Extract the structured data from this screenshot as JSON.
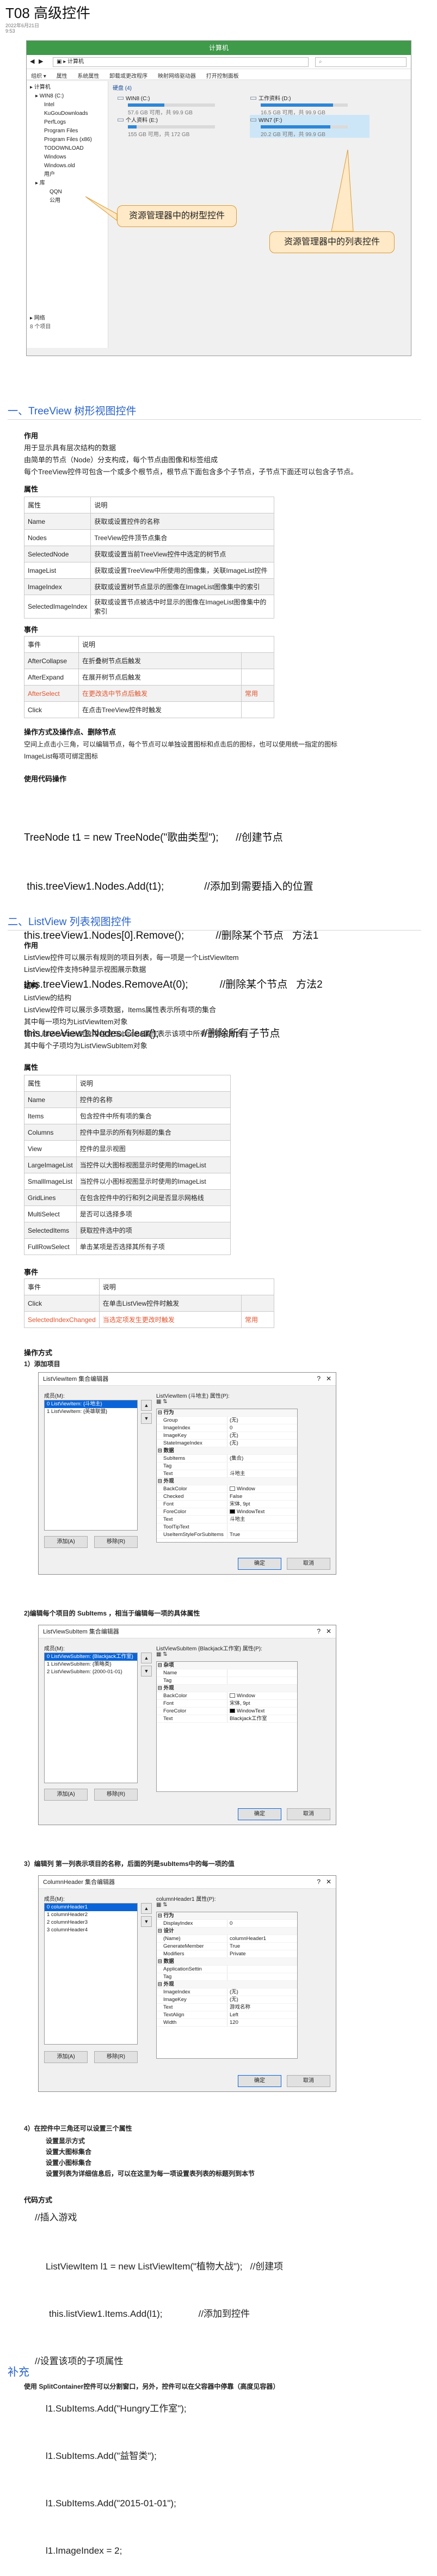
{
  "page": {
    "title": "T08 高级控件",
    "date": "2022年6月21日",
    "time": "9:53"
  },
  "explorer": {
    "window_title": "计算机",
    "path": "计算机",
    "menu": [
      "组织 ▾",
      "属性",
      "系统属性",
      "卸载或更改程序",
      "映射网络驱动器",
      "打开控制面板"
    ],
    "tree": [
      "▸ 计算机",
      "▸ WIN8 (C:)",
      "Intel",
      "KuGouDownloads",
      "PerfLogs",
      "Program Files",
      "Program Files (x86)",
      "TODOWNLOAD",
      "Windows",
      "Windows.old",
      "用户",
      "▸ 库",
      "QQN",
      "公用",
      "▸ 网络"
    ],
    "tree_footer": "8 个项目",
    "group": "硬盘 (4)",
    "drives": [
      {
        "name": "WIN8 (C:)",
        "free": "57.6 GB 可用，共 99.9 GB",
        "used": 0.42
      },
      {
        "name": "工作资料 (D:)",
        "free": "16.5 GB 可用，共 99.9 GB",
        "used": 0.83
      },
      {
        "name": "个人资料 (E:)",
        "free": "155 GB 可用，共 172 GB",
        "used": 0.1
      },
      {
        "name": "WIN7 (F:)",
        "free": "20.2 GB 可用，共 99.9 GB",
        "used": 0.8
      }
    ],
    "callout_tree": "资源管理器中的树型控件",
    "callout_list": "资源管理器中的列表控件"
  },
  "treeview": {
    "heading": "一、TreeView 树形视图控件",
    "purpose_label": "作用",
    "purpose_lines": [
      "用于显示具有层次结构的数据",
      "由简单的节点（Node）分支构成，每个节点由图像和标签组成",
      "每个TreeView控件可包含一个或多个根节点，根节点下面包含多个子节点，子节点下面还可以包含子节点。"
    ],
    "props_label": "属性",
    "props_header": [
      "属性",
      "说明"
    ],
    "props": [
      [
        "Name",
        "获取或设置控件的名称"
      ],
      [
        "Nodes",
        "TreeView控件顶节点集合"
      ],
      [
        "SelectedNode",
        "获取或设置当前TreeView控件中选定的树节点"
      ],
      [
        "ImageList",
        "获取或设置TreeView中所使用的图像集，关联ImageList控件"
      ],
      [
        "ImageIndex",
        "获取或设置树节点显示的图像在ImageList图像集中的索引"
      ],
      [
        "SelectedImageIndex",
        "获取或设置节点被选中时显示的图像在ImageList图像集中的索引"
      ]
    ],
    "events_label": "事件",
    "events_header": [
      "事件",
      "说明"
    ],
    "events": [
      [
        "AfterCollapse",
        "在折叠树节点后触发",
        ""
      ],
      [
        "AfterExpand",
        "在展开树节点后触发",
        ""
      ],
      [
        "AfterSelect",
        "在更改选中节点后触发",
        "常用"
      ],
      [
        "Click",
        "在点击TreeView控件时触发",
        ""
      ]
    ],
    "ops_label": "操作方式及操作点、删除节点",
    "ops_lines": [
      "空间上点击小三角，可以编辑节点，每个节点可以单独设置图标和点击后的图标，也可以使用统一指定的图标",
      "ImageList每项可绑定图标"
    ],
    "code_label": "使用代码操作",
    "code": [
      "TreeNode t1 = new TreeNode(\"歌曲类型\");      //创建节点",
      " this.treeView1.Nodes.Add(t1);              //添加到需要插入的位置",
      "this.treeView1.Nodes[0].Remove();           //删除某个节点   方法1",
      "this.treeView1.Nodes.RemoveAt(0);           //删除某个节点   方法2",
      "this.treeView1.Nodes.Clear();               //删除所有子节点"
    ]
  },
  "listview": {
    "heading": "二、ListView 列表视图控件",
    "purpose_label": "作用",
    "purpose_lines": [
      "ListView控件可以展示有规则的项目列表，每一项是一个ListViewItem",
      "ListView控件支持5种显示视图展示数据"
    ],
    "struct_label": "结构",
    "struct_lines": [
      "ListView的结构",
      "ListView控件可以展示多项数据，Items属性表示所有项的集合",
      "其中每一项均为ListViewItem对象",
      "每个ListViewItem对象中包含SubItems属性表示该项中所有子项的集合",
      "其中每个子项均为ListViewSubItem对象"
    ],
    "props_label": "属性",
    "props_header": [
      "属性",
      "说明"
    ],
    "props": [
      [
        "Name",
        "控件的名称"
      ],
      [
        "Items",
        "包含控件中所有项的集合"
      ],
      [
        "Columns",
        "控件中显示的所有列标题的集合"
      ],
      [
        "View",
        "控件的显示视图"
      ],
      [
        "LargeImageList",
        "当控件以大图标视图显示时使用的ImageList"
      ],
      [
        "SmallImageList",
        "当控件以小图标视图显示时使用的ImageList"
      ],
      [
        "GridLines",
        "在包含控件中的行和列之间是否显示网格线"
      ],
      [
        "MultiSelect",
        "是否可以选择多项"
      ],
      [
        "SelectedItems",
        "获取控件选中的项"
      ],
      [
        "FullRowSelect",
        "单击某项是否选择其所有子项"
      ]
    ],
    "events_label": "事件",
    "events_header": [
      "事件",
      "说明"
    ],
    "events": [
      [
        "Click",
        "在单击ListView控件时触发",
        ""
      ],
      [
        "SelectedIndexChanged",
        "当选定项发生更改时触发",
        "常用"
      ]
    ],
    "ops_label": "操作方式",
    "step1": "1）添加项目",
    "step2": "2)编辑每个项目的 SubItems  ，相当于编辑每一项的具体属性",
    "step3": "3）编辑列  第一列表示项目的名称，后面的列是subItems中的每一项的值",
    "step4_title": "4）在控件中三角还可以设置三个属性",
    "step4_lines": [
      "设置显示方式",
      "设置大图标集合",
      "设置小图标集合",
      "设置列表为详细信息后，可以在这里为每一项设置表列表的标题列到本节"
    ],
    "code_label": "代码方式",
    "code_comment": "//插入游戏",
    "code": [
      "ListViewItem l1 = new ListViewItem(\"植物大战\");   //创建项",
      "this.listView1.Items.Add(l1);              //添加到控件",
      "//设置该项的子项属性",
      "l1.SubItems.Add(\"Hungry工作室\");",
      "l1.SubItems.Add(\"益智类\");",
      "l1.SubItems.Add(\"2015-01-01\");",
      "l1.ImageIndex = 2;"
    ],
    "supp_heading": "补充",
    "supp_line": "使用 SplitContainer控件可以分割窗口，另外，控件可以在父容器中停靠（高度见容器）"
  },
  "dialog1": {
    "title": "ListViewItem 集合编辑器",
    "members_label": "成员(M):",
    "members": [
      "0  ListViewItem: {斗地主}",
      "1  ListViewItem: {英雄联盟}"
    ],
    "props_label": "ListViewItem (斗地主) 属性(P):",
    "add": "添加(A)",
    "remove": "移除(R)",
    "ok": "确定",
    "cancel": "取消",
    "grid": [
      {
        "cat": "行为"
      },
      {
        "k": "Group",
        "v": "(无)"
      },
      {
        "k": "ImageIndex",
        "v": "0"
      },
      {
        "k": "ImageKey",
        "v": "(无)"
      },
      {
        "k": "StateImageIndex",
        "v": "(无)"
      },
      {
        "cat": "数据"
      },
      {
        "k": "SubItems",
        "v": "(集合)"
      },
      {
        "k": "Tag",
        "v": ""
      },
      {
        "k": "Text",
        "v": "斗地主"
      },
      {
        "cat": "外观"
      },
      {
        "k": "BackColor",
        "v": "Window",
        "sw": "#ffffff"
      },
      {
        "k": "Checked",
        "v": "False"
      },
      {
        "k": "Font",
        "v": "宋体, 9pt"
      },
      {
        "k": "ForeColor",
        "v": "WindowText",
        "sw": "#000000"
      },
      {
        "k": "Text",
        "v": "斗地主"
      },
      {
        "k": "ToolTipText",
        "v": ""
      },
      {
        "k": "UseItemStyleForSubItems",
        "v": "True"
      }
    ]
  },
  "dialog2": {
    "title": "ListViewSubItem 集合编辑器",
    "members_label": "成员(M):",
    "members": [
      "0  ListViewSubItem: {Blackjack工作室}",
      "1  ListViewSubItem: {策略类}",
      "2  ListViewSubItem: {2000-01-01}"
    ],
    "props_label": "ListViewSubItem {Blackjack工作室} 属性(P):",
    "add": "添加(A)",
    "remove": "移除(R)",
    "ok": "确定",
    "cancel": "取消",
    "grid": [
      {
        "cat": "杂项"
      },
      {
        "k": "Name",
        "v": ""
      },
      {
        "k": "Tag",
        "v": ""
      },
      {
        "cat": "外观"
      },
      {
        "k": "BackColor",
        "v": "Window",
        "sw": "#ffffff"
      },
      {
        "k": "Font",
        "v": "宋体, 9pt"
      },
      {
        "k": "ForeColor",
        "v": "WindowText",
        "sw": "#000000"
      },
      {
        "k": "Text",
        "v": "Blackjack工作室"
      }
    ]
  },
  "dialog3": {
    "title": "ColumnHeader 集合编辑器",
    "members_label": "成员(M):",
    "members": [
      "0  columnHeader1",
      "1  columnHeader2",
      "2  columnHeader3",
      "3  columnHeader4"
    ],
    "props_label": "columnHeader1 属性(P):",
    "add": "添加(A)",
    "remove": "移除(R)",
    "ok": "确定",
    "cancel": "取消",
    "grid": [
      {
        "cat": "行为"
      },
      {
        "k": "DisplayIndex",
        "v": "0"
      },
      {
        "cat": "设计"
      },
      {
        "k": "(Name)",
        "v": "columnHeader1"
      },
      {
        "k": "GenerateMember",
        "v": "True"
      },
      {
        "k": "Modifiers",
        "v": "Private"
      },
      {
        "cat": "数据"
      },
      {
        "k": "ApplicationSettin",
        "v": ""
      },
      {
        "k": "Tag",
        "v": ""
      },
      {
        "cat": "外观"
      },
      {
        "k": "ImageIndex",
        "v": "(无)"
      },
      {
        "k": "ImageKey",
        "v": "(无)"
      },
      {
        "k": "Text",
        "v": "游戏名称"
      },
      {
        "k": "TextAlign",
        "v": "Left"
      },
      {
        "k": "Width",
        "v": "120"
      }
    ]
  }
}
